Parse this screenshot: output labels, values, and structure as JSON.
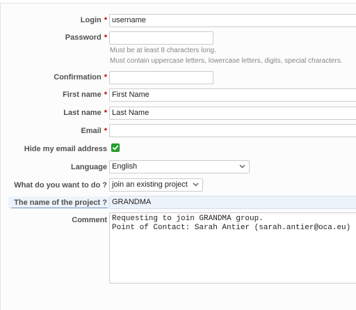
{
  "form": {
    "login": {
      "label": "Login",
      "required": "*",
      "value": "username"
    },
    "password": {
      "label": "Password",
      "required": "*",
      "value": "",
      "hints": [
        "Must be at least 8 characters long.",
        "Must contain uppercase letters, lowercase letters, digits, special characters."
      ]
    },
    "confirmation": {
      "label": "Confirmation",
      "required": "*",
      "value": ""
    },
    "first_name": {
      "label": "First name",
      "required": "*",
      "value": "First Name"
    },
    "last_name": {
      "label": "Last name",
      "required": "*",
      "value": "Last Name"
    },
    "email": {
      "label": "Email",
      "required": "*",
      "value": ""
    },
    "hide_email": {
      "label": "Hide my email address",
      "checked": true
    },
    "language": {
      "label": "Language",
      "value": "English"
    },
    "action": {
      "label": "What do you want to do ?",
      "value": "join an existing project"
    },
    "project": {
      "label": "The name of the project ?",
      "value": "GRANDMA"
    },
    "comment": {
      "label": "Comment",
      "value": "Requesting to join GRANDMA group.\nPoint of Contact: Sarah Antier (sarah.antier@oca.eu)"
    }
  },
  "colors": {
    "required": "#bb0000",
    "checkbox": "#22a32a",
    "highlight_row": "#edf3fb"
  }
}
